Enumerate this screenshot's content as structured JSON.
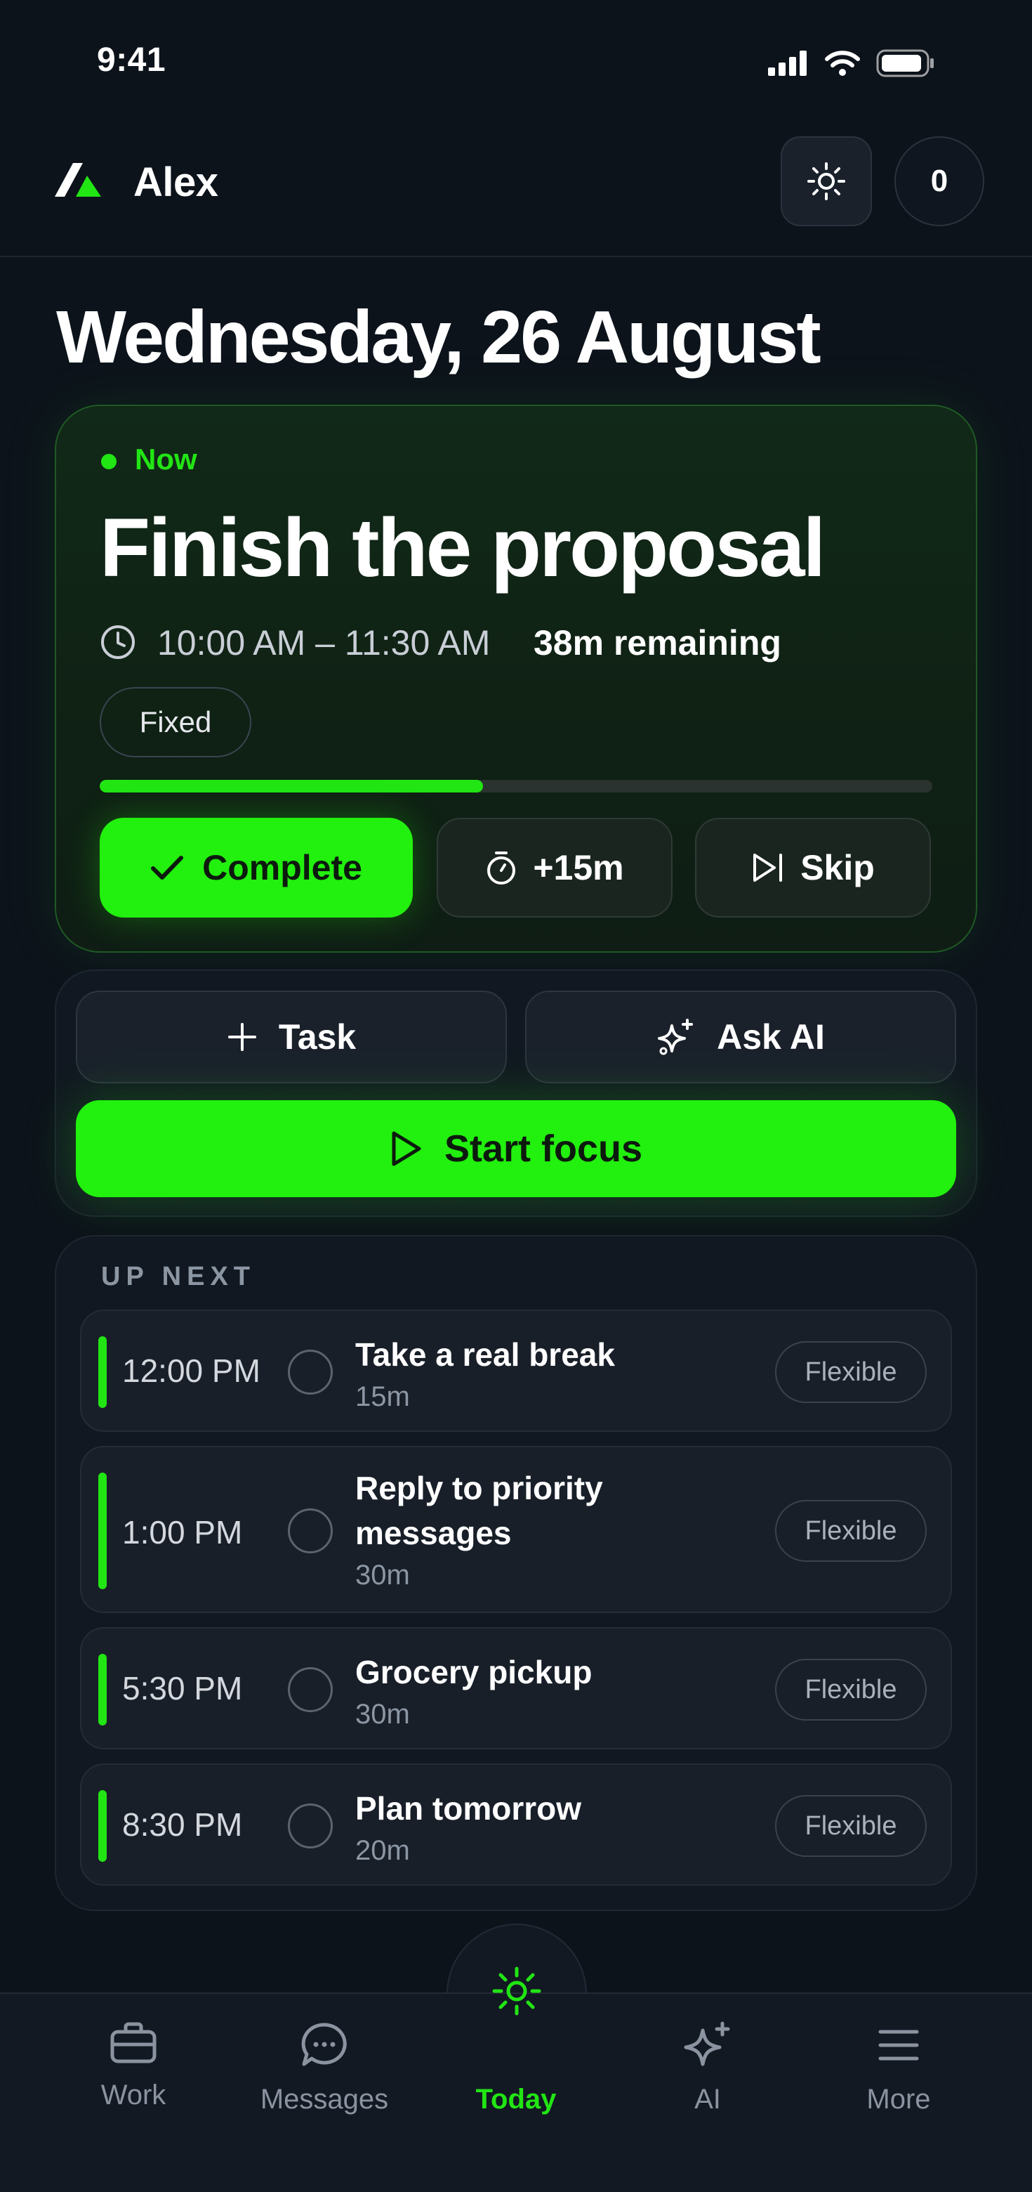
{
  "status_bar": {
    "time": "9:41"
  },
  "header": {
    "user_name": "Alex",
    "count": "0"
  },
  "date_title": "Wednesday, 26 August",
  "now_card": {
    "label": "Now",
    "title": "Finish the proposal",
    "time_range": "10:00 AM – 11:30 AM",
    "remaining": "38m remaining",
    "badge": "Fixed",
    "progress": 0.46,
    "complete_label": "Complete",
    "extend_label": "+15m",
    "skip_label": "Skip"
  },
  "actions": {
    "task_label": "Task",
    "ai_label": "Ask AI",
    "focus_label": "Start focus"
  },
  "up_next": {
    "title": "UP NEXT",
    "items": [
      {
        "time": "12:00 PM",
        "title": "Take a real break",
        "duration": "15m",
        "badge": "Flexible"
      },
      {
        "time": "1:00 PM",
        "title": "Reply to priority messages",
        "duration": "30m",
        "badge": "Flexible"
      },
      {
        "time": "5:30 PM",
        "title": "Grocery pickup",
        "duration": "30m",
        "badge": "Flexible"
      },
      {
        "time": "8:30 PM",
        "title": "Plan tomorrow",
        "duration": "20m",
        "badge": "Flexible"
      }
    ]
  },
  "nav": {
    "items": [
      {
        "label": "Work",
        "icon": "briefcase-icon"
      },
      {
        "label": "Messages",
        "icon": "chat-bubble-icon"
      },
      {
        "label": "Today",
        "icon": "sun-icon"
      },
      {
        "label": "AI",
        "icon": "sparkle-icon"
      },
      {
        "label": "More",
        "icon": "menu-icon"
      }
    ],
    "active": "Today"
  },
  "colors": {
    "accent": "#22e514",
    "background": "#0d131b",
    "card": "#181f29"
  }
}
